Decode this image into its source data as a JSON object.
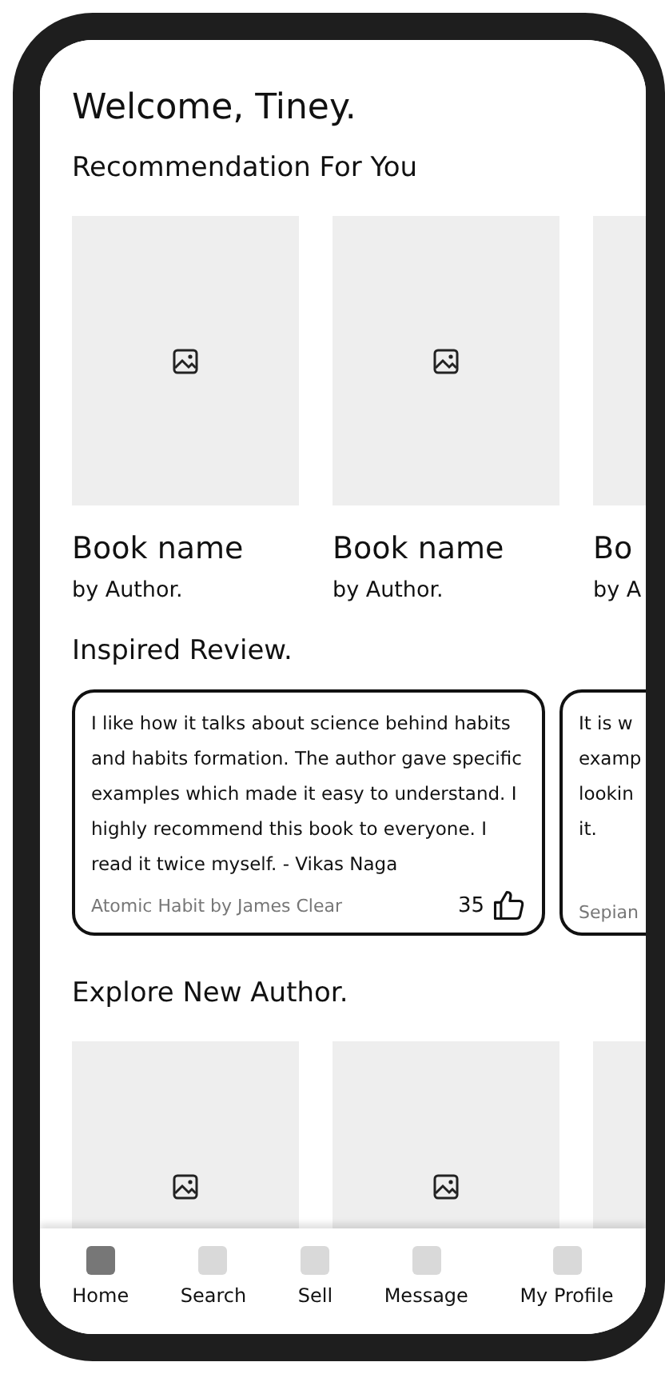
{
  "greeting": "Welcome, Tiney.",
  "recommendations": {
    "title": "Recommendation For You",
    "books": [
      {
        "kind": "full",
        "name": "Book name",
        "author": "by Author."
      },
      {
        "kind": "full",
        "name": "Book name",
        "author": "by Author."
      },
      {
        "kind": "clipped",
        "name": "Bo",
        "author": "by A"
      }
    ]
  },
  "reviews": {
    "title": "Inspired Review.",
    "items": [
      {
        "kind": "full",
        "text": "I like how it talks about science behind habits and habits formation. The author gave specific examples which made it easy to understand. I highly recommend this book to everyone. I read it twice myself. - Vikas Naga",
        "source": "Atomic Habit by James Clear",
        "likes": "35"
      },
      {
        "kind": "clipped",
        "lines": [
          "It is w",
          "examp",
          "lookin",
          "it."
        ],
        "source": "Sepian"
      }
    ]
  },
  "authors": {
    "title": "Explore New Author.",
    "items": [
      {
        "kind": "placeholder"
      },
      {
        "kind": "placeholder"
      },
      {
        "kind": "clipped"
      }
    ]
  },
  "nav": [
    {
      "label": "Home",
      "selected": true
    },
    {
      "label": "Search",
      "selected": false
    },
    {
      "label": "Sell",
      "selected": false
    },
    {
      "label": "Message",
      "selected": false
    },
    {
      "label": "My Profile",
      "selected": false
    }
  ]
}
